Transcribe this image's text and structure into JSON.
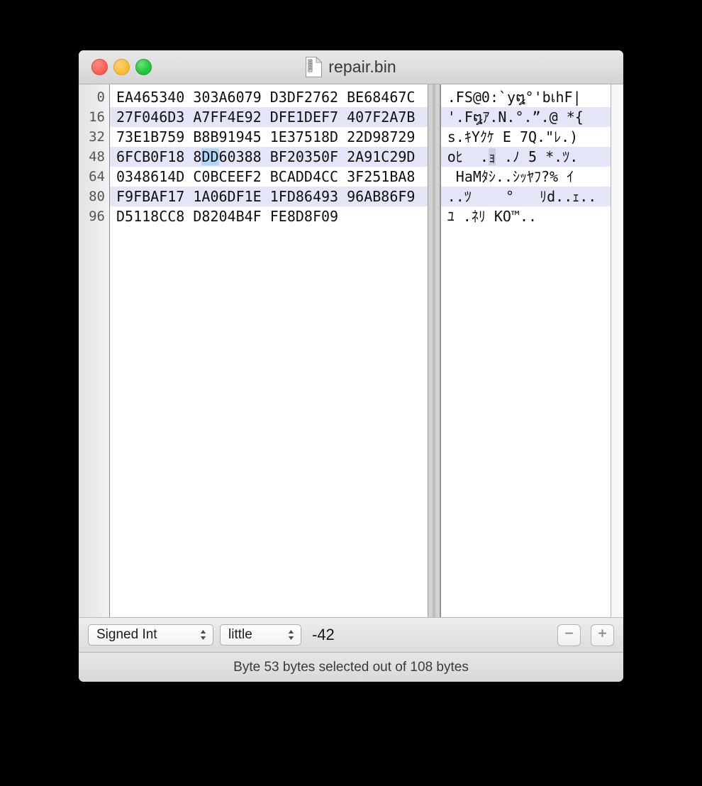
{
  "window": {
    "title": "repair.bin",
    "doc_icon": "document-icon",
    "traffic_lights": [
      {
        "name": "close",
        "color": "#fd5f57"
      },
      {
        "name": "minimize",
        "color": "#febc2e"
      },
      {
        "name": "zoom",
        "color": "#24c33b"
      }
    ]
  },
  "hex_editor": {
    "offsets": [
      "0",
      "16",
      "32",
      "48",
      "64",
      "80",
      "96"
    ],
    "rows": [
      {
        "offset": "0",
        "hex": "EA465340 303A6079 D3DF2762 BE68467C",
        "ascii": ".FS@0:`y໘°'bเhF|",
        "highlighted": false
      },
      {
        "offset": "16",
        "hex": "27F046D3 A7FF4E92 DFE1DEF7 407F2A7B",
        "ascii": "'.F໘ｱ.N.°.ˮ.@ *{",
        "highlighted": true
      },
      {
        "offset": "32",
        "hex": "73E1B759 B8B91945 1E37518D 22D98729",
        "ascii": "s.ｷYｸｹ E 7Q.\"ﾚ.)",
        "highlighted": false
      },
      {
        "offset": "48",
        "hex": "6FCB0F18 8DD60388 BF20350F 2A91C29D",
        "ascii": "oﾋ  .ｮ .ﾉ 5 *.ﾂ.",
        "highlighted": true,
        "selection_hex": {
          "start_index": 10,
          "length": 2,
          "text": "D6"
        },
        "selection_ascii": {
          "start_index": 5,
          "length": 1,
          "text": "ｮ"
        }
      },
      {
        "offset": "64",
        "hex": "0348614D C0BCEEF2 BCADD4CC 3F251BA8",
        "ascii": " HaMﾀｼ..ｼｯﾔﾌ?% ｲ",
        "highlighted": false
      },
      {
        "offset": "80",
        "hex": "F9FBAF17 1A06DF1E 1FD86493 96AB86F9",
        "ascii": "..ﾂ    °   ﾘd..ｪ..",
        "highlighted": true
      },
      {
        "offset": "96",
        "hex": "D5118CC8 D8204B4F FE8D8F09",
        "ascii": "ﾕ .ﾈﾘ KO™..",
        "highlighted": false
      }
    ]
  },
  "inspector": {
    "type_select": {
      "label": "Signed Int",
      "icon": "chevron-up-down-icon"
    },
    "endian_select": {
      "label": "little",
      "icon": "chevron-up-down-icon"
    },
    "value": "-42",
    "minus_button": {
      "label": "−",
      "icon": "minus-icon"
    },
    "plus_button": {
      "label": "+",
      "icon": "plus-icon"
    }
  },
  "statusbar": {
    "text": "Byte 53 bytes selected out of 108 bytes"
  },
  "colors": {
    "alt_row": "#e4e6f7",
    "hex_selection": "#aed6f7",
    "ascii_selection": "#c8cfe0",
    "window_chrome": "#ececec",
    "desktop": "#000000"
  }
}
